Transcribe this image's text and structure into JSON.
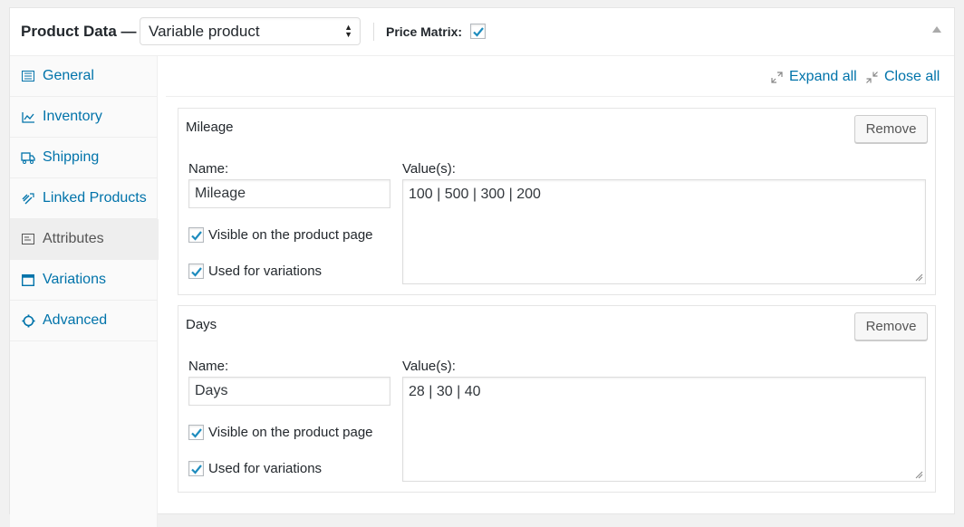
{
  "header": {
    "title": "Product Data —",
    "product_type": "Variable product",
    "price_matrix_label": "Price Matrix:",
    "price_matrix_checked": true
  },
  "sidebar": {
    "items": [
      {
        "label": "General",
        "icon": "general-icon"
      },
      {
        "label": "Inventory",
        "icon": "inventory-icon"
      },
      {
        "label": "Shipping",
        "icon": "truck-icon"
      },
      {
        "label": "Linked Products",
        "icon": "link-icon"
      },
      {
        "label": "Attributes",
        "icon": "attributes-icon",
        "active": true
      },
      {
        "label": "Variations",
        "icon": "window-icon"
      },
      {
        "label": "Advanced",
        "icon": "gear-icon"
      }
    ]
  },
  "toolbar": {
    "expand_label": "Expand all",
    "close_label": "Close all"
  },
  "attributes": [
    {
      "title": "Mileage",
      "remove_label": "Remove",
      "name_label": "Name:",
      "name_value": "Mileage",
      "values_label": "Value(s):",
      "values": "100 | 500 | 300 | 200",
      "visible_label": "Visible on the product page",
      "variations_label": "Used for variations"
    },
    {
      "title": "Days",
      "remove_label": "Remove",
      "name_label": "Name:",
      "name_value": "Days",
      "values_label": "Value(s):",
      "values": "28 | 30 | 40",
      "visible_label": "Visible on the product page",
      "variations_label": "Used for variations"
    }
  ],
  "colors": {
    "link": "#0073aa",
    "text": "#23282d"
  }
}
